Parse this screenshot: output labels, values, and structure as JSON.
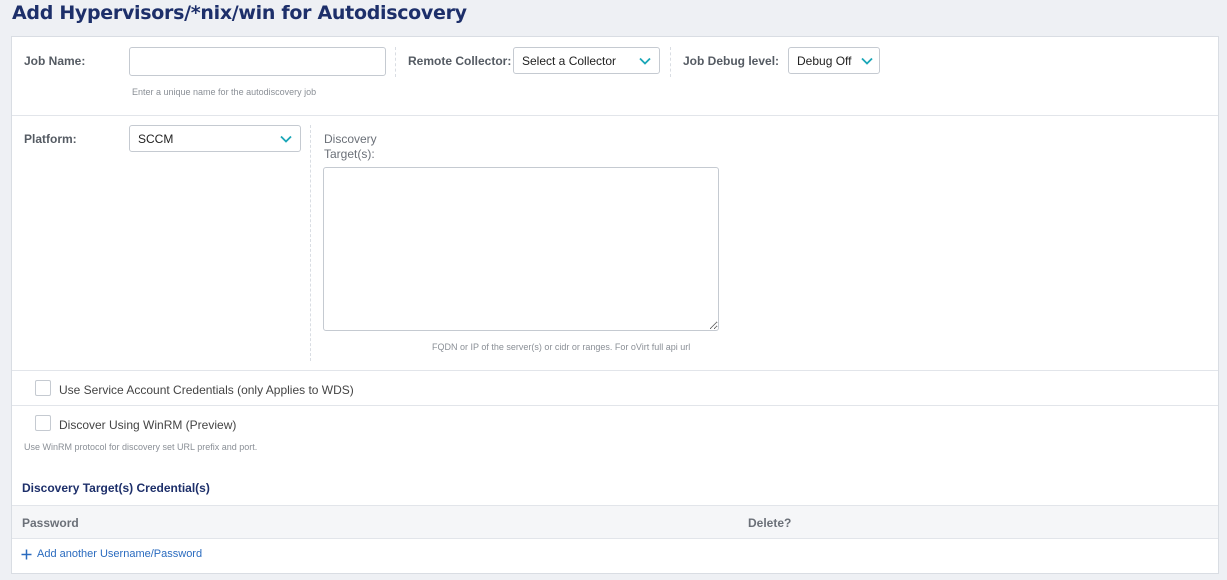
{
  "page": {
    "title": "Add Hypervisors/*nix/win for Autodiscovery"
  },
  "job_name": {
    "label": "Job Name:",
    "value": "",
    "hint": "Enter a unique name for the autodiscovery job"
  },
  "remote_collector": {
    "label": "Remote Collector:",
    "selected": "Select a Collector"
  },
  "debug_level": {
    "label": "Job Debug level:",
    "selected": "Debug Off"
  },
  "platform": {
    "label": "Platform:",
    "selected": "SCCM"
  },
  "discovery_targets": {
    "label_line1": "Discovery",
    "label_line2": "Target(s):",
    "value": "",
    "hint": "FQDN or IP of the server(s) or cidr or ranges. For oVirt full api url"
  },
  "service_account": {
    "label": "Use Service Account Credentials (only Applies to WDS)",
    "checked": false
  },
  "winrm": {
    "label": "Discover Using WinRM (Preview)",
    "checked": false,
    "hint": "Use WinRM protocol for discovery set URL prefix and port."
  },
  "credentials": {
    "heading": "Discovery Target(s) Credential(s)",
    "columns": [
      "Password",
      "Delete?"
    ],
    "add_link": "Add another Username/Password"
  },
  "colors": {
    "accent": "#1aa6b7",
    "title": "#1d2f6a",
    "link": "#2a6bbf"
  },
  "icons": {
    "dropdown": "chevron-down-icon",
    "add": "plus-icon"
  }
}
